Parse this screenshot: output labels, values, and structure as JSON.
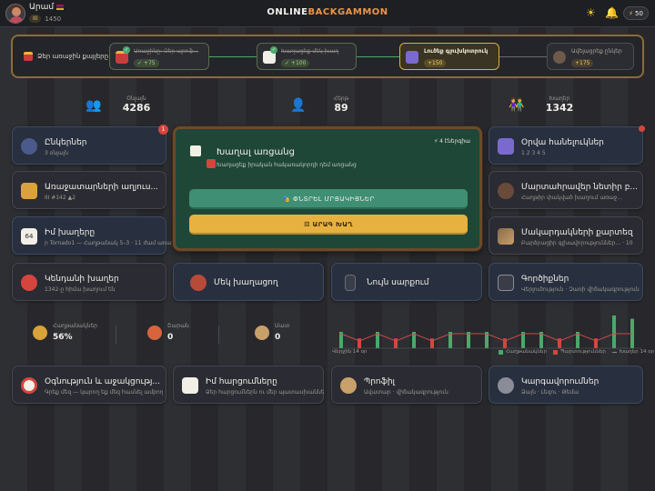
{
  "topbar": {
    "username": "Արամ",
    "level": "III",
    "rating": "1450",
    "logo_main": "ONLINE",
    "logo_accent": "BACKGAMMON",
    "coins": "50",
    "icons": [
      "day-night-icon",
      "bell-icon",
      "bolt-icon"
    ]
  },
  "first_steps": {
    "label": "Ձեր առաջին քայլերը",
    "steps": [
      {
        "title": "Առաջինը: Ձեր պրոֆ...",
        "reward": "✓ +75",
        "state": "done"
      },
      {
        "title": "Խաղացեք մեկ խաղ",
        "reward": "✓ +100",
        "state": "done"
      },
      {
        "title": "Լուծեք գլուխկոտրուկ",
        "reward": "+150",
        "state": "active"
      },
      {
        "title": "Ավելացրեք ընկեր",
        "reward": "+175",
        "state": "todo"
      }
    ]
  },
  "counters": [
    {
      "label": "Օնլայն",
      "value": "4286"
    },
    {
      "label": "Հերթ",
      "value": "89"
    },
    {
      "label": "Խաղեր",
      "value": "1342"
    }
  ],
  "left_cards": [
    {
      "title": "Ընկերներ",
      "sub": "3 օնլայն",
      "badge": "1"
    },
    {
      "title": "Առաջատարների աղյուս...",
      "sub": "III  #142  ▲2"
    },
    {
      "title": "Իմ խաղերը",
      "sub": "ր Tornado1 — Հաղթանակ 5–3 · 11 ժամ առաջ"
    },
    {
      "title": "Կենդանի խաղեր",
      "sub": "1342-ը հիմա խաղում են"
    }
  ],
  "right_cards": [
    {
      "title": "Օրվա հանելուկներ",
      "sub": "1 2 3 4 5"
    },
    {
      "title": "Մարտահրավեր նետիր բ...",
      "sub": "Հաղթիր փակված խաղում առաջ..."
    },
    {
      "title": "Մակարդակների քարտեզ",
      "sub": "Բարձրացիր գլխավորություններ... · 10"
    },
    {
      "title": "Գործիքներ",
      "sub": "Վերլուծություն · Զառի վիճակագրություն"
    }
  ],
  "play_panel": {
    "title": "Խաղալ առցանց",
    "subtitle": "Խաղացեք իրական հակառակորդի դեմ առցանց",
    "online": "⚡ 4 էներգիա",
    "find_button": "🎭 ՓՆՏՐԵԼ ՄՐՑԱԿԻՑՆԵՐ",
    "quick_button": "⚄ ԱՐԱԳ ԽԱՂ"
  },
  "mode_cards": [
    {
      "title": "Մեկ խաղացող"
    },
    {
      "title": "Նույն սարքում"
    }
  ],
  "stats": [
    {
      "label": "Հաղթանակներ",
      "value": "56%"
    },
    {
      "label": "Շարան",
      "value": "0"
    },
    {
      "label": "Մատ",
      "value": "0"
    }
  ],
  "chart_data": {
    "type": "bar",
    "xlabel": "Վերջին 14 օր",
    "legend": [
      "Հաղթանակներ",
      "Պարտություններ",
      "Խաղեր 14 օր"
    ],
    "colors": {
      "win": "#4aa86a",
      "loss": "#d6453d",
      "line": "#c84a4a"
    },
    "wins": [
      1,
      0,
      1,
      0,
      1,
      0,
      1,
      1,
      1,
      0,
      1,
      1,
      0,
      1,
      0,
      1,
      1
    ],
    "heights": [
      0.5,
      0.3,
      0.5,
      0.3,
      0.5,
      0.3,
      0.5,
      0.5,
      0.5,
      0.3,
      0.5,
      0.5,
      0.3,
      0.5,
      0.3,
      1,
      0.9
    ]
  },
  "bottom_cards": [
    {
      "title": "Օգնություն և աջակցությ...",
      "sub": "Գրեք մեզ — կարող եք մեզ հասնել ամբողջ օրը"
    },
    {
      "title": "Իմ հարցումները",
      "sub": "Ձեր հարցումներն ու մեր պատասխանները մեկ տեղում"
    },
    {
      "title": "Պրոֆիլ",
      "sub": "Ավատար · վիճակագրություն"
    },
    {
      "title": "Կարգավորումներ",
      "sub": "Ձայն · Լեզու · Թեմա"
    }
  ]
}
